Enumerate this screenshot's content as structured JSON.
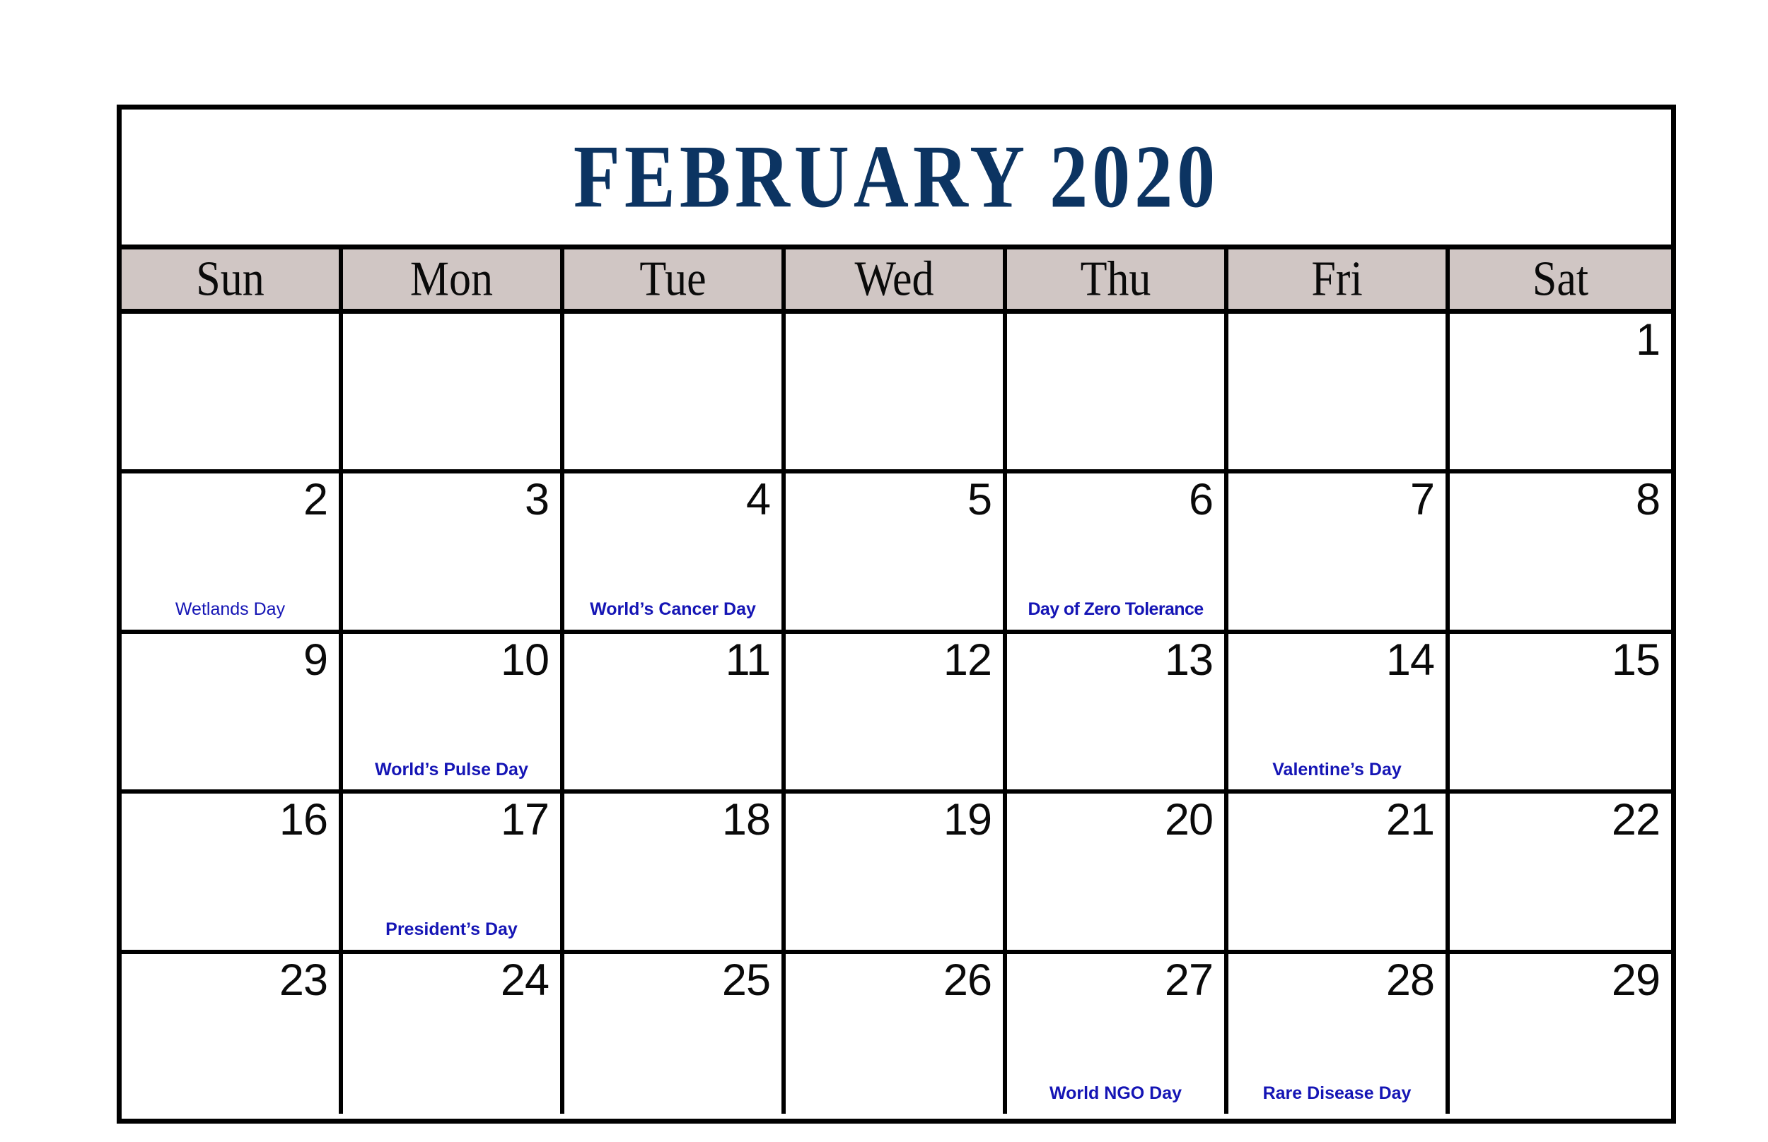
{
  "calendar": {
    "title": "FEBRUARY 2020",
    "month": "February",
    "year": "2020",
    "accent_title_color": "#0C3462",
    "header_bg_color": "#D0C6C4",
    "event_text_color": "#1515B5",
    "border_color": "#000000",
    "weekdays": [
      {
        "short": "Sun"
      },
      {
        "short": "Mon"
      },
      {
        "short": "Tue"
      },
      {
        "short": "Wed"
      },
      {
        "short": "Thu"
      },
      {
        "short": "Fri"
      },
      {
        "short": "Sat"
      }
    ],
    "weeks": [
      [
        {
          "day": "",
          "event": ""
        },
        {
          "day": "",
          "event": ""
        },
        {
          "day": "",
          "event": ""
        },
        {
          "day": "",
          "event": ""
        },
        {
          "day": "",
          "event": ""
        },
        {
          "day": "",
          "event": ""
        },
        {
          "day": "1",
          "event": ""
        }
      ],
      [
        {
          "day": "2",
          "event": "Wetlands Day",
          "event_weight": "light"
        },
        {
          "day": "3",
          "event": ""
        },
        {
          "day": "4",
          "event": "World’s Cancer Day"
        },
        {
          "day": "5",
          "event": ""
        },
        {
          "day": "6",
          "event": "Day of Zero Tolerance",
          "event_fit": "tight"
        },
        {
          "day": "7",
          "event": ""
        },
        {
          "day": "8",
          "event": ""
        }
      ],
      [
        {
          "day": "9",
          "event": ""
        },
        {
          "day": "10",
          "event": "World’s Pulse Day"
        },
        {
          "day": "11",
          "event": ""
        },
        {
          "day": "12",
          "event": ""
        },
        {
          "day": "13",
          "event": ""
        },
        {
          "day": "14",
          "event": "Valentine’s Day"
        },
        {
          "day": "15",
          "event": ""
        }
      ],
      [
        {
          "day": "16",
          "event": ""
        },
        {
          "day": "17",
          "event": "President’s Day"
        },
        {
          "day": "18",
          "event": ""
        },
        {
          "day": "19",
          "event": ""
        },
        {
          "day": "20",
          "event": ""
        },
        {
          "day": "21",
          "event": ""
        },
        {
          "day": "22",
          "event": ""
        }
      ],
      [
        {
          "day": "23",
          "event": ""
        },
        {
          "day": "24",
          "event": ""
        },
        {
          "day": "25",
          "event": ""
        },
        {
          "day": "26",
          "event": ""
        },
        {
          "day": "27",
          "event": "World NGO Day"
        },
        {
          "day": "28",
          "event": "Rare Disease Day"
        },
        {
          "day": "29",
          "event": ""
        }
      ]
    ]
  }
}
